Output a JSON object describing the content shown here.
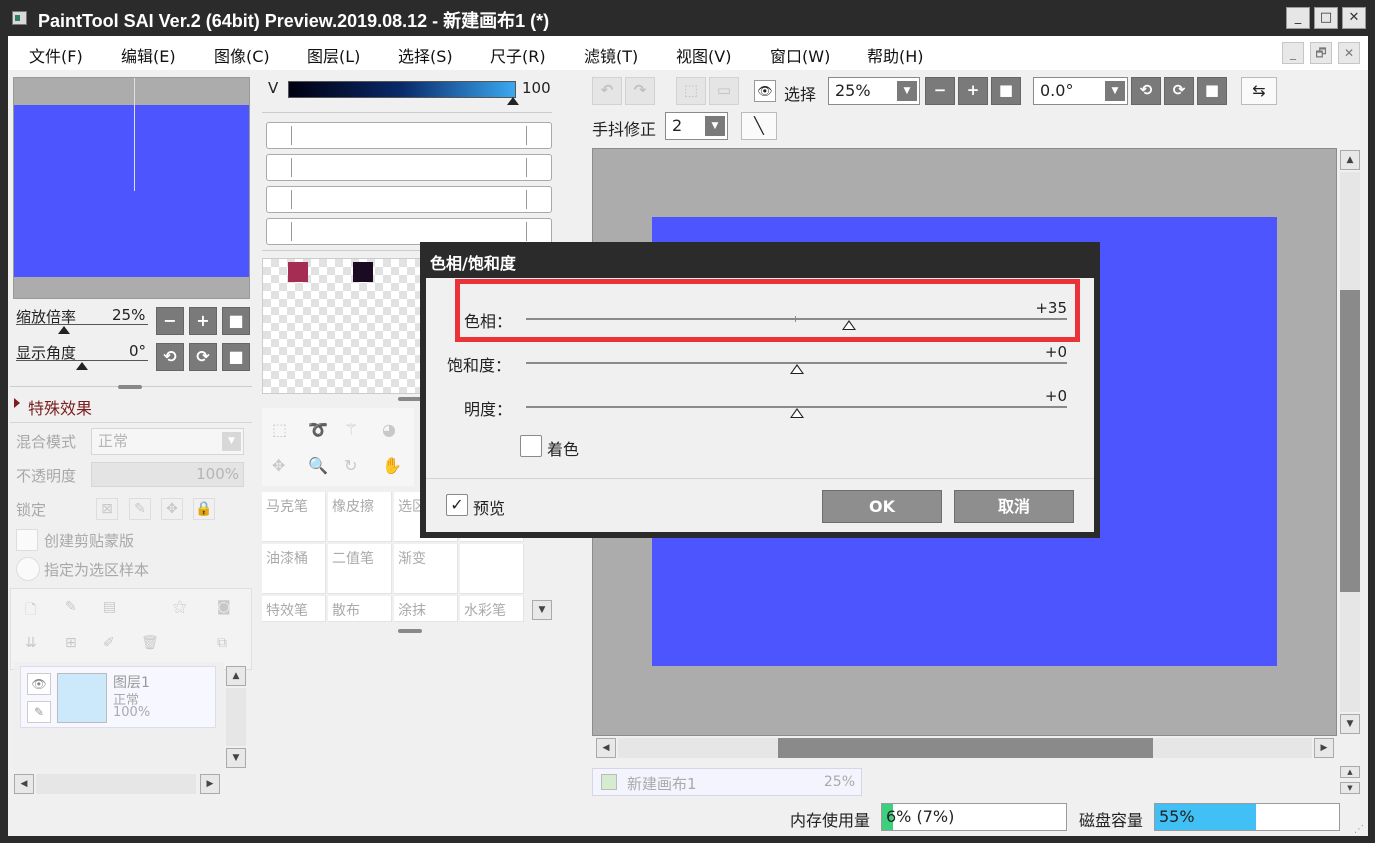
{
  "window": {
    "title": "PaintTool SAI Ver.2 (64bit) Preview.2019.08.12 - 新建画布1 (*)",
    "minimize": "_",
    "maximize": "□",
    "close": "✕"
  },
  "menu": {
    "items": [
      "文件(F)",
      "编辑(E)",
      "图像(C)",
      "图层(L)",
      "选择(S)",
      "尺子(R)",
      "滤镜(T)",
      "视图(V)",
      "窗口(W)",
      "帮助(H)"
    ],
    "mdi_minimize": "_",
    "mdi_restore": "🗗",
    "mdi_close": "✕"
  },
  "navigator": {
    "zoom_label": "缩放倍率",
    "zoom_value": "25%",
    "angle_label": "显示角度",
    "angle_value": "0°",
    "btn_minus": "−",
    "btn_plus": "+",
    "btn_reset": "■",
    "btn_rot_left": "⟲",
    "btn_rot_right": "⟳"
  },
  "effects": {
    "header": "特殊效果"
  },
  "layer_props": {
    "blend_label": "混合模式",
    "blend_value": "正常",
    "opacity_label": "不透明度",
    "opacity_value": "100%",
    "lock_label": "锁定",
    "clip_label": "创建剪贴蒙版",
    "sample_label": "指定为选区样本"
  },
  "layer": {
    "name": "图层1",
    "mode": "正常",
    "opacity": "100%"
  },
  "color": {
    "channel": "V",
    "value": "100",
    "swatch_colors": [
      "#a52c52",
      "#1a0a22"
    ]
  },
  "tools": {
    "row1": [
      "马克笔",
      "橡皮擦",
      "选区"
    ],
    "row2": [
      "油漆桶",
      "二值笔",
      "渐变"
    ],
    "row3": [
      "特效笔",
      "散布",
      "涂抹",
      "水彩笔"
    ]
  },
  "toolbar": {
    "select_label": "选择",
    "zoom_value": "25%",
    "rotation_value": "0.0°",
    "stabilizer_label": "手抖修正",
    "stabilizer_value": "2"
  },
  "doc_tab": {
    "name": "新建画布1",
    "zoom": "25%"
  },
  "dialog": {
    "title": "色相/饱和度",
    "hue_label": "色相：",
    "hue_value": "+35",
    "sat_label": "饱和度：",
    "sat_value": "+0",
    "light_label": "明度：",
    "light_value": "+0",
    "colorize_label": "着色",
    "preview_label": "预览",
    "preview_check": "✓",
    "ok_label": "OK",
    "cancel_label": "取消"
  },
  "sliders": {
    "hue_fraction": 0.597,
    "sat_fraction": 0.5,
    "light_fraction": 0.5
  },
  "status": {
    "memory_label": "内存使用量",
    "memory_value": "6% (7%)",
    "memory_fraction": 0.06,
    "disk_label": "磁盘容量",
    "disk_value": "55%",
    "disk_fraction": 0.55
  },
  "colors": {
    "canvas_blue": "#4d55fe",
    "highlight_red": "#ea3338",
    "disk_fill": "#40c0f4",
    "memory_fill": "#3ccf7d"
  }
}
